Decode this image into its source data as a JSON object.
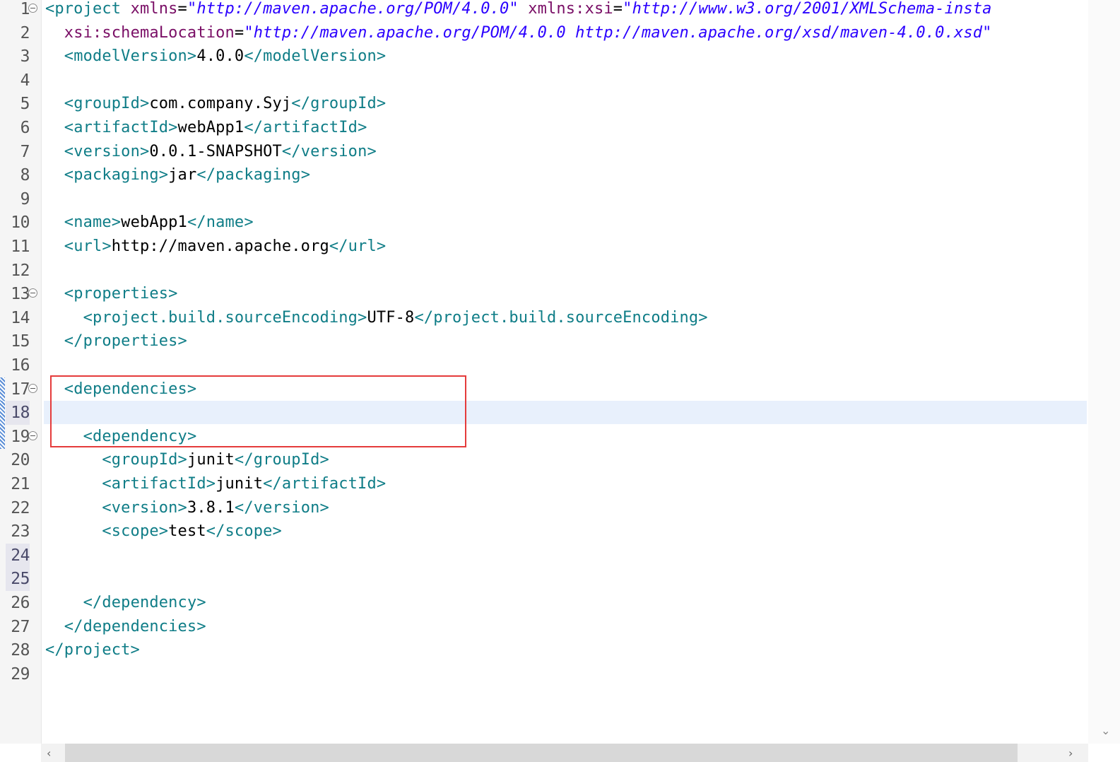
{
  "editor": {
    "lines": [
      {
        "n": "1",
        "fold": true,
        "seg": [
          [
            "tag",
            "<project "
          ],
          [
            "attr",
            "xmlns"
          ],
          [
            "txt",
            "="
          ],
          [
            "str",
            "\"http://maven.apache.org/POM/4.0.0\""
          ],
          [
            "txt",
            " "
          ],
          [
            "attr",
            "xmlns:xsi"
          ],
          [
            "txt",
            "="
          ],
          [
            "str",
            "\"http://www.w3.org/2001/XMLSchema-insta"
          ]
        ]
      },
      {
        "n": "2",
        "seg": [
          [
            "txt",
            "  "
          ],
          [
            "attr",
            "xsi:schemaLocation"
          ],
          [
            "txt",
            "="
          ],
          [
            "str",
            "\"http://maven.apache.org/POM/4.0.0 http://maven.apache.org/xsd/maven-4.0.0.xsd\""
          ]
        ]
      },
      {
        "n": "3",
        "seg": [
          [
            "txt",
            "  "
          ],
          [
            "tag",
            "<modelVersion>"
          ],
          [
            "txt",
            "4.0.0"
          ],
          [
            "tag",
            "</modelVersion>"
          ]
        ]
      },
      {
        "n": "4",
        "seg": []
      },
      {
        "n": "5",
        "seg": [
          [
            "txt",
            "  "
          ],
          [
            "tag",
            "<groupId>"
          ],
          [
            "txt",
            "com.company.Syj"
          ],
          [
            "tag",
            "</groupId>"
          ]
        ]
      },
      {
        "n": "6",
        "seg": [
          [
            "txt",
            "  "
          ],
          [
            "tag",
            "<artifactId>"
          ],
          [
            "txt",
            "webApp1"
          ],
          [
            "tag",
            "</artifactId>"
          ]
        ]
      },
      {
        "n": "7",
        "seg": [
          [
            "txt",
            "  "
          ],
          [
            "tag",
            "<version>"
          ],
          [
            "txt",
            "0.0.1-SNAPSHOT"
          ],
          [
            "tag",
            "</version>"
          ]
        ]
      },
      {
        "n": "8",
        "seg": [
          [
            "txt",
            "  "
          ],
          [
            "tag",
            "<packaging>"
          ],
          [
            "txt",
            "jar"
          ],
          [
            "tag",
            "</packaging>"
          ]
        ]
      },
      {
        "n": "9",
        "seg": []
      },
      {
        "n": "10",
        "seg": [
          [
            "txt",
            "  "
          ],
          [
            "tag",
            "<name>"
          ],
          [
            "txt",
            "webApp1"
          ],
          [
            "tag",
            "</name>"
          ]
        ]
      },
      {
        "n": "11",
        "seg": [
          [
            "txt",
            "  "
          ],
          [
            "tag",
            "<url>"
          ],
          [
            "txt",
            "http://maven.apache.org"
          ],
          [
            "tag",
            "</url>"
          ]
        ]
      },
      {
        "n": "12",
        "seg": []
      },
      {
        "n": "13",
        "fold": true,
        "seg": [
          [
            "txt",
            "  "
          ],
          [
            "tag",
            "<properties>"
          ]
        ]
      },
      {
        "n": "14",
        "seg": [
          [
            "txt",
            "    "
          ],
          [
            "tag",
            "<project.build.sourceEncoding>"
          ],
          [
            "txt",
            "UTF-8"
          ],
          [
            "tag",
            "</project.build.sourceEncoding>"
          ]
        ]
      },
      {
        "n": "15",
        "seg": [
          [
            "txt",
            "  "
          ],
          [
            "tag",
            "</properties>"
          ]
        ]
      },
      {
        "n": "16",
        "seg": []
      },
      {
        "n": "17",
        "fold": true,
        "mark": true,
        "seg": [
          [
            "txt",
            "  "
          ],
          [
            "tag",
            "<dependencies>"
          ]
        ]
      },
      {
        "n": "18",
        "hl": true,
        "mark": true,
        "seg": []
      },
      {
        "n": "19",
        "fold": true,
        "mark": true,
        "seg": [
          [
            "txt",
            "    "
          ],
          [
            "tag",
            "<dependency>"
          ]
        ]
      },
      {
        "n": "20",
        "seg": [
          [
            "txt",
            "      "
          ],
          [
            "tag",
            "<groupId>"
          ],
          [
            "txt",
            "junit"
          ],
          [
            "tag",
            "</groupId>"
          ]
        ]
      },
      {
        "n": "21",
        "seg": [
          [
            "txt",
            "      "
          ],
          [
            "tag",
            "<artifactId>"
          ],
          [
            "txt",
            "junit"
          ],
          [
            "tag",
            "</artifactId>"
          ]
        ]
      },
      {
        "n": "22",
        "seg": [
          [
            "txt",
            "      "
          ],
          [
            "tag",
            "<version>"
          ],
          [
            "txt",
            "3.8.1"
          ],
          [
            "tag",
            "</version>"
          ]
        ]
      },
      {
        "n": "23",
        "seg": [
          [
            "txt",
            "      "
          ],
          [
            "tag",
            "<scope>"
          ],
          [
            "txt",
            "test"
          ],
          [
            "tag",
            "</scope>"
          ]
        ]
      },
      {
        "n": "24",
        "hl": true,
        "seg": []
      },
      {
        "n": "25",
        "hl": true,
        "seg": []
      },
      {
        "n": "26",
        "seg": [
          [
            "txt",
            "    "
          ],
          [
            "tag",
            "</dependency>"
          ]
        ]
      },
      {
        "n": "27",
        "seg": [
          [
            "txt",
            "  "
          ],
          [
            "tag",
            "</dependencies>"
          ]
        ]
      },
      {
        "n": "28",
        "seg": [
          [
            "tag",
            "</project>"
          ]
        ]
      },
      {
        "n": "29",
        "seg": []
      }
    ]
  },
  "scroll": {
    "down_icon": "chevron-down-icon",
    "left_icon": "chevron-left-icon",
    "right_icon": "chevron-right-icon",
    "down_glyph": "⌄",
    "left_glyph": "‹",
    "right_glyph": "›"
  },
  "colors": {
    "tag": "#0f7d87",
    "attr": "#7a0f66",
    "string": "#2a00ff",
    "highlight_box": "#e53b3b",
    "current_line": "#e8f0fc"
  }
}
